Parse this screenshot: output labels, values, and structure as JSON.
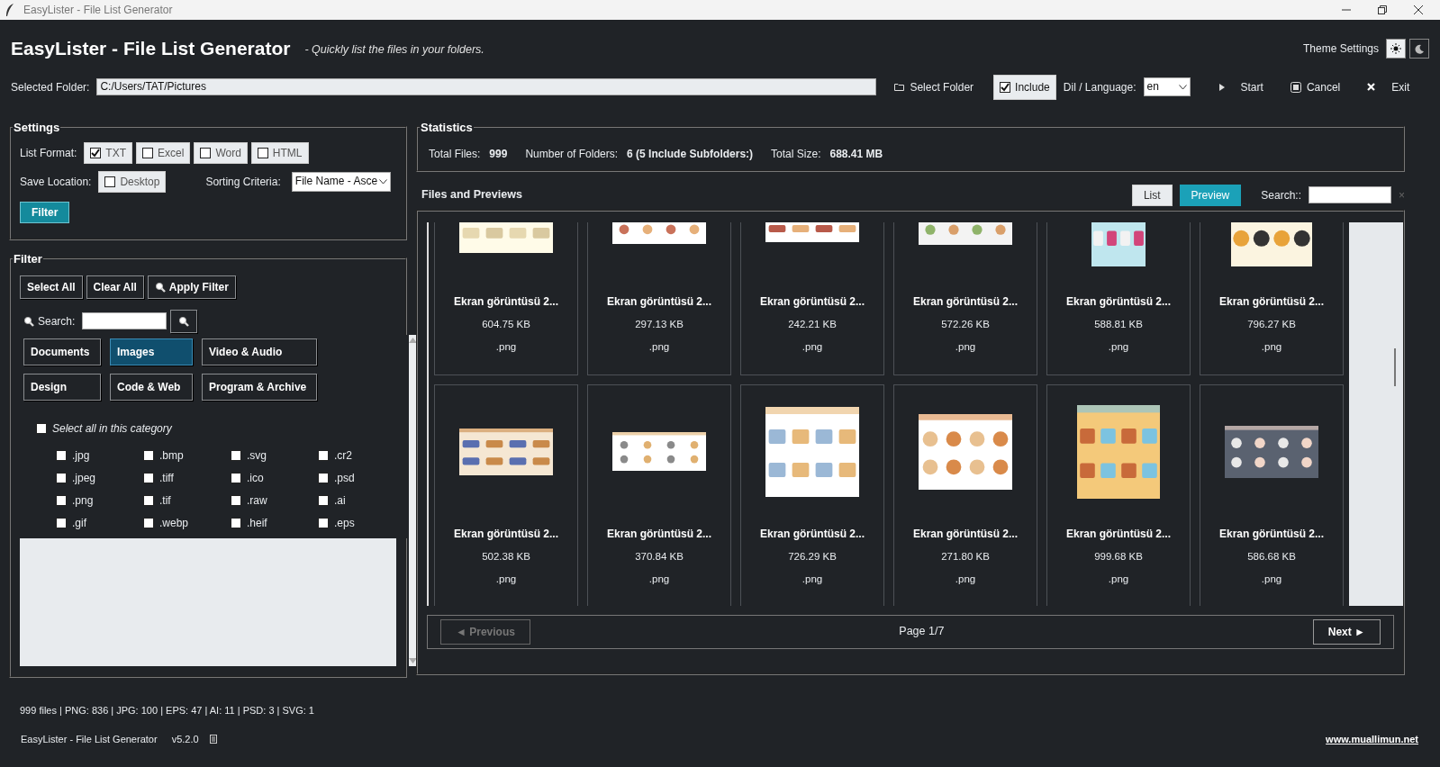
{
  "window": {
    "title": "EasyLister - File List Generator"
  },
  "header": {
    "title": "EasyLister - File List Generator",
    "subtitle": "- Quickly list the files in your folders.",
    "theme_label": "Theme Settings",
    "theme_buttons": [
      {
        "kind": "sun",
        "selected": true
      },
      {
        "kind": "moon",
        "selected": false
      }
    ]
  },
  "toolbar": {
    "folder_label": "Selected Folder:",
    "folder_value": "C:/Users/TAT/Pictures",
    "select_folder": "Select Folder",
    "include": {
      "label": "Include",
      "checked": true
    },
    "language_label": "Dil / Language:",
    "language_value": "en",
    "start": "Start",
    "cancel": "Cancel",
    "exit": "Exit"
  },
  "settings": {
    "title": "Settings",
    "format_label": "List Format:",
    "formats": [
      {
        "label": "TXT",
        "checked": true
      },
      {
        "label": "Excel",
        "checked": false
      },
      {
        "label": "Word",
        "checked": false
      },
      {
        "label": "HTML",
        "checked": false
      }
    ],
    "save_label": "Save Location:",
    "save_options": [
      {
        "label": "Desktop",
        "checked": false
      }
    ],
    "sort_label": "Sorting Criteria:",
    "sort_value": "File Name - Asce",
    "filter_button": "Filter"
  },
  "filter": {
    "title": "Filter",
    "actions": [
      "Select All",
      "Clear All",
      "Apply Filter"
    ],
    "search_label": "Search:",
    "categories": [
      {
        "label": "Documents",
        "selected": false
      },
      {
        "label": "Images",
        "selected": true
      },
      {
        "label": "Video & Audio",
        "selected": false
      },
      {
        "label": "Design",
        "selected": false
      },
      {
        "label": "Code & Web",
        "selected": false
      },
      {
        "label": "Program & Archive",
        "selected": false
      }
    ],
    "select_all": {
      "label": "Select all in this category",
      "checked": false
    },
    "extensions": [
      {
        "label": ".jpg",
        "checked": false
      },
      {
        "label": ".bmp",
        "checked": false
      },
      {
        "label": ".svg",
        "checked": false
      },
      {
        "label": ".cr2",
        "checked": false
      },
      {
        "label": ".jpeg",
        "checked": false
      },
      {
        "label": ".tiff",
        "checked": false
      },
      {
        "label": ".ico",
        "checked": false
      },
      {
        "label": ".psd",
        "checked": false
      },
      {
        "label": ".png",
        "checked": false
      },
      {
        "label": ".tif",
        "checked": false
      },
      {
        "label": ".raw",
        "checked": false
      },
      {
        "label": ".ai",
        "checked": false
      },
      {
        "label": ".gif",
        "checked": false
      },
      {
        "label": ".webp",
        "checked": false
      },
      {
        "label": ".heif",
        "checked": false
      },
      {
        "label": ".eps",
        "checked": false
      }
    ]
  },
  "statistics": {
    "title": "Statistics",
    "items": [
      {
        "label": "Total Files:",
        "value": "999"
      },
      {
        "label": "Number of Folders:",
        "value": "6 (5 Include Subfolders:)"
      },
      {
        "label": "Total Size:",
        "value": "688.41 MB"
      }
    ]
  },
  "files": {
    "title": "Files and Previews",
    "views": [
      {
        "label": "List",
        "selected": false
      },
      {
        "label": "Preview",
        "selected": true
      }
    ],
    "search_label": "Search::",
    "clear_symbol": "×",
    "cards": [
      {
        "name": "Ekran görüntüsü 2...",
        "size": "604.75 KB",
        "ext": ".png"
      },
      {
        "name": "Ekran görüntüsü 2...",
        "size": "297.13 KB",
        "ext": ".png"
      },
      {
        "name": "Ekran görüntüsü 2...",
        "size": "242.21 KB",
        "ext": ".png"
      },
      {
        "name": "Ekran görüntüsü 2...",
        "size": "572.26 KB",
        "ext": ".png"
      },
      {
        "name": "Ekran görüntüsü 2...",
        "size": "588.81 KB",
        "ext": ".png"
      },
      {
        "name": "Ekran görüntüsü 2...",
        "size": "796.27 KB",
        "ext": ".png"
      },
      {
        "name": "Ekran görüntüsü 2...",
        "size": "502.38 KB",
        "ext": ".png"
      },
      {
        "name": "Ekran görüntüsü 2...",
        "size": "370.84 KB",
        "ext": ".png"
      },
      {
        "name": "Ekran görüntüsü 2...",
        "size": "726.29 KB",
        "ext": ".png"
      },
      {
        "name": "Ekran görüntüsü 2...",
        "size": "271.80 KB",
        "ext": ".png"
      },
      {
        "name": "Ekran görüntüsü 2...",
        "size": "999.68 KB",
        "ext": ".png"
      },
      {
        "name": "Ekran görüntüsü 2...",
        "size": "586.68 KB",
        "ext": ".png"
      }
    ],
    "pagination": {
      "previous": {
        "label": "◄ Previous",
        "disabled": true
      },
      "page": "Page 1/7",
      "next": {
        "label": "Next ►",
        "disabled": false
      }
    }
  },
  "status_bar": {
    "summary": "999 files | PNG: 836 | JPG: 100 | EPS: 47 | AI: 11 | PSD: 3 | SVG: 1",
    "app_name": "EasyLister - File List Generator",
    "version": "v5.2.0",
    "link": "www.muallimun.net"
  }
}
